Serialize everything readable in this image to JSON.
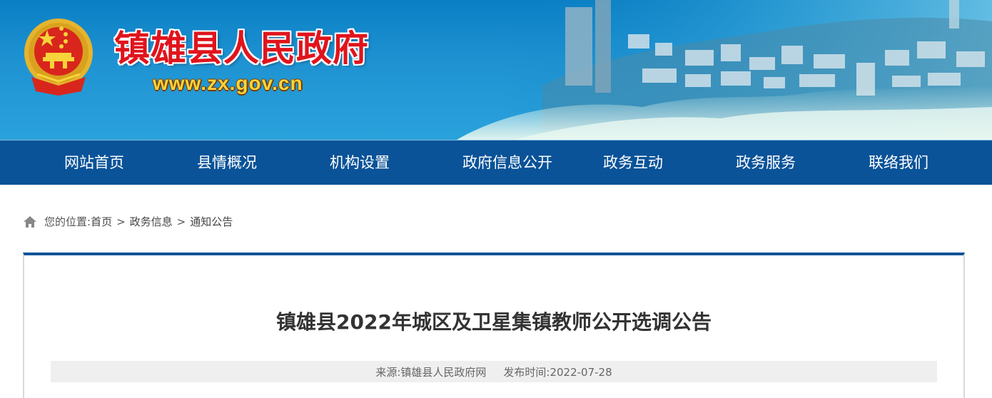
{
  "header": {
    "site_name": "镇雄县人民政府",
    "site_url": "www.zx.gov.cn",
    "emblem_icon": "national-emblem-icon"
  },
  "nav": {
    "items": [
      {
        "label": "网站首页"
      },
      {
        "label": "县情概况"
      },
      {
        "label": "机构设置"
      },
      {
        "label": "政府信息公开"
      },
      {
        "label": "政务互动"
      },
      {
        "label": "政务服务"
      },
      {
        "label": "联络我们"
      }
    ]
  },
  "breadcrumb": {
    "prefix": "您的位置:",
    "home_icon": "home-icon",
    "items": [
      "首页",
      "政务信息",
      "通知公告"
    ],
    "separator": ">"
  },
  "article": {
    "title": "镇雄县2022年城区及卫星集镇教师公开选调公告",
    "source": "来源:镇雄县人民政府网",
    "publish_time": "发布时间:2022-07-28"
  },
  "colors": {
    "nav_bg": "#0a5398",
    "site_name": "#e0141c",
    "site_url": "#f6d43a"
  }
}
